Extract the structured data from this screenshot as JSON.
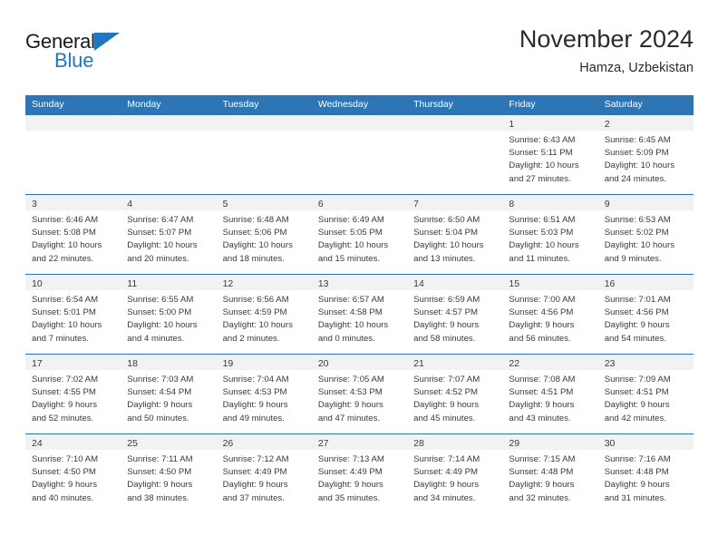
{
  "brand": {
    "name_part1": "General",
    "name_part2": "Blue",
    "accent_color": "#1F77C2"
  },
  "header": {
    "title": "November 2024",
    "subtitle": "Hamza, Uzbekistan"
  },
  "theme": {
    "header_blue": "#2E75B6",
    "day_strip_gray": "#F2F2F2",
    "text_color": "#3a3a3a"
  },
  "weekdays": [
    "Sunday",
    "Monday",
    "Tuesday",
    "Wednesday",
    "Thursday",
    "Friday",
    "Saturday"
  ],
  "weeks": [
    [
      {
        "day": "",
        "sunrise": "",
        "sunset": "",
        "daylight1": "",
        "daylight2": ""
      },
      {
        "day": "",
        "sunrise": "",
        "sunset": "",
        "daylight1": "",
        "daylight2": ""
      },
      {
        "day": "",
        "sunrise": "",
        "sunset": "",
        "daylight1": "",
        "daylight2": ""
      },
      {
        "day": "",
        "sunrise": "",
        "sunset": "",
        "daylight1": "",
        "daylight2": ""
      },
      {
        "day": "",
        "sunrise": "",
        "sunset": "",
        "daylight1": "",
        "daylight2": ""
      },
      {
        "day": "1",
        "sunrise": "Sunrise: 6:43 AM",
        "sunset": "Sunset: 5:11 PM",
        "daylight1": "Daylight: 10 hours",
        "daylight2": "and 27 minutes."
      },
      {
        "day": "2",
        "sunrise": "Sunrise: 6:45 AM",
        "sunset": "Sunset: 5:09 PM",
        "daylight1": "Daylight: 10 hours",
        "daylight2": "and 24 minutes."
      }
    ],
    [
      {
        "day": "3",
        "sunrise": "Sunrise: 6:46 AM",
        "sunset": "Sunset: 5:08 PM",
        "daylight1": "Daylight: 10 hours",
        "daylight2": "and 22 minutes."
      },
      {
        "day": "4",
        "sunrise": "Sunrise: 6:47 AM",
        "sunset": "Sunset: 5:07 PM",
        "daylight1": "Daylight: 10 hours",
        "daylight2": "and 20 minutes."
      },
      {
        "day": "5",
        "sunrise": "Sunrise: 6:48 AM",
        "sunset": "Sunset: 5:06 PM",
        "daylight1": "Daylight: 10 hours",
        "daylight2": "and 18 minutes."
      },
      {
        "day": "6",
        "sunrise": "Sunrise: 6:49 AM",
        "sunset": "Sunset: 5:05 PM",
        "daylight1": "Daylight: 10 hours",
        "daylight2": "and 15 minutes."
      },
      {
        "day": "7",
        "sunrise": "Sunrise: 6:50 AM",
        "sunset": "Sunset: 5:04 PM",
        "daylight1": "Daylight: 10 hours",
        "daylight2": "and 13 minutes."
      },
      {
        "day": "8",
        "sunrise": "Sunrise: 6:51 AM",
        "sunset": "Sunset: 5:03 PM",
        "daylight1": "Daylight: 10 hours",
        "daylight2": "and 11 minutes."
      },
      {
        "day": "9",
        "sunrise": "Sunrise: 6:53 AM",
        "sunset": "Sunset: 5:02 PM",
        "daylight1": "Daylight: 10 hours",
        "daylight2": "and 9 minutes."
      }
    ],
    [
      {
        "day": "10",
        "sunrise": "Sunrise: 6:54 AM",
        "sunset": "Sunset: 5:01 PM",
        "daylight1": "Daylight: 10 hours",
        "daylight2": "and 7 minutes."
      },
      {
        "day": "11",
        "sunrise": "Sunrise: 6:55 AM",
        "sunset": "Sunset: 5:00 PM",
        "daylight1": "Daylight: 10 hours",
        "daylight2": "and 4 minutes."
      },
      {
        "day": "12",
        "sunrise": "Sunrise: 6:56 AM",
        "sunset": "Sunset: 4:59 PM",
        "daylight1": "Daylight: 10 hours",
        "daylight2": "and 2 minutes."
      },
      {
        "day": "13",
        "sunrise": "Sunrise: 6:57 AM",
        "sunset": "Sunset: 4:58 PM",
        "daylight1": "Daylight: 10 hours",
        "daylight2": "and 0 minutes."
      },
      {
        "day": "14",
        "sunrise": "Sunrise: 6:59 AM",
        "sunset": "Sunset: 4:57 PM",
        "daylight1": "Daylight: 9 hours",
        "daylight2": "and 58 minutes."
      },
      {
        "day": "15",
        "sunrise": "Sunrise: 7:00 AM",
        "sunset": "Sunset: 4:56 PM",
        "daylight1": "Daylight: 9 hours",
        "daylight2": "and 56 minutes."
      },
      {
        "day": "16",
        "sunrise": "Sunrise: 7:01 AM",
        "sunset": "Sunset: 4:56 PM",
        "daylight1": "Daylight: 9 hours",
        "daylight2": "and 54 minutes."
      }
    ],
    [
      {
        "day": "17",
        "sunrise": "Sunrise: 7:02 AM",
        "sunset": "Sunset: 4:55 PM",
        "daylight1": "Daylight: 9 hours",
        "daylight2": "and 52 minutes."
      },
      {
        "day": "18",
        "sunrise": "Sunrise: 7:03 AM",
        "sunset": "Sunset: 4:54 PM",
        "daylight1": "Daylight: 9 hours",
        "daylight2": "and 50 minutes."
      },
      {
        "day": "19",
        "sunrise": "Sunrise: 7:04 AM",
        "sunset": "Sunset: 4:53 PM",
        "daylight1": "Daylight: 9 hours",
        "daylight2": "and 49 minutes."
      },
      {
        "day": "20",
        "sunrise": "Sunrise: 7:05 AM",
        "sunset": "Sunset: 4:53 PM",
        "daylight1": "Daylight: 9 hours",
        "daylight2": "and 47 minutes."
      },
      {
        "day": "21",
        "sunrise": "Sunrise: 7:07 AM",
        "sunset": "Sunset: 4:52 PM",
        "daylight1": "Daylight: 9 hours",
        "daylight2": "and 45 minutes."
      },
      {
        "day": "22",
        "sunrise": "Sunrise: 7:08 AM",
        "sunset": "Sunset: 4:51 PM",
        "daylight1": "Daylight: 9 hours",
        "daylight2": "and 43 minutes."
      },
      {
        "day": "23",
        "sunrise": "Sunrise: 7:09 AM",
        "sunset": "Sunset: 4:51 PM",
        "daylight1": "Daylight: 9 hours",
        "daylight2": "and 42 minutes."
      }
    ],
    [
      {
        "day": "24",
        "sunrise": "Sunrise: 7:10 AM",
        "sunset": "Sunset: 4:50 PM",
        "daylight1": "Daylight: 9 hours",
        "daylight2": "and 40 minutes."
      },
      {
        "day": "25",
        "sunrise": "Sunrise: 7:11 AM",
        "sunset": "Sunset: 4:50 PM",
        "daylight1": "Daylight: 9 hours",
        "daylight2": "and 38 minutes."
      },
      {
        "day": "26",
        "sunrise": "Sunrise: 7:12 AM",
        "sunset": "Sunset: 4:49 PM",
        "daylight1": "Daylight: 9 hours",
        "daylight2": "and 37 minutes."
      },
      {
        "day": "27",
        "sunrise": "Sunrise: 7:13 AM",
        "sunset": "Sunset: 4:49 PM",
        "daylight1": "Daylight: 9 hours",
        "daylight2": "and 35 minutes."
      },
      {
        "day": "28",
        "sunrise": "Sunrise: 7:14 AM",
        "sunset": "Sunset: 4:49 PM",
        "daylight1": "Daylight: 9 hours",
        "daylight2": "and 34 minutes."
      },
      {
        "day": "29",
        "sunrise": "Sunrise: 7:15 AM",
        "sunset": "Sunset: 4:48 PM",
        "daylight1": "Daylight: 9 hours",
        "daylight2": "and 32 minutes."
      },
      {
        "day": "30",
        "sunrise": "Sunrise: 7:16 AM",
        "sunset": "Sunset: 4:48 PM",
        "daylight1": "Daylight: 9 hours",
        "daylight2": "and 31 minutes."
      }
    ]
  ]
}
